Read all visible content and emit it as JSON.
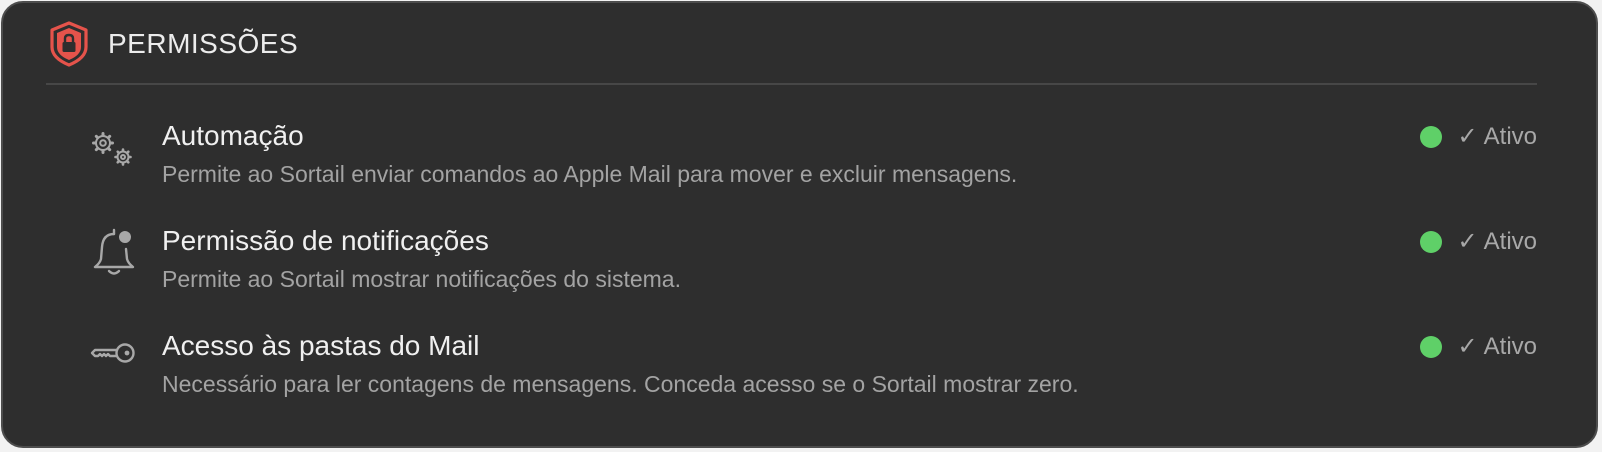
{
  "section": {
    "title": "PERMISSÕES",
    "icon": "shield-lock-icon",
    "accent": "#e5534b"
  },
  "permissions": [
    {
      "icon": "gears-icon",
      "title": "Automação",
      "description": "Permite ao Sortail enviar comandos ao Apple Mail para mover e excluir mensagens.",
      "status": "Ativo",
      "status_mark": "✓",
      "status_color": "#5fd068"
    },
    {
      "icon": "bell-badge-icon",
      "title": "Permissão de notificações",
      "description": "Permite ao Sortail mostrar notificações do sistema.",
      "status": "Ativo",
      "status_mark": "✓",
      "status_color": "#5fd068"
    },
    {
      "icon": "key-icon",
      "title": "Acesso às pastas do Mail",
      "description": "Necessário para ler contagens de mensagens. Conceda acesso se o Sortail mostrar zero.",
      "status": "Ativo",
      "status_mark": "✓",
      "status_color": "#5fd068"
    }
  ]
}
